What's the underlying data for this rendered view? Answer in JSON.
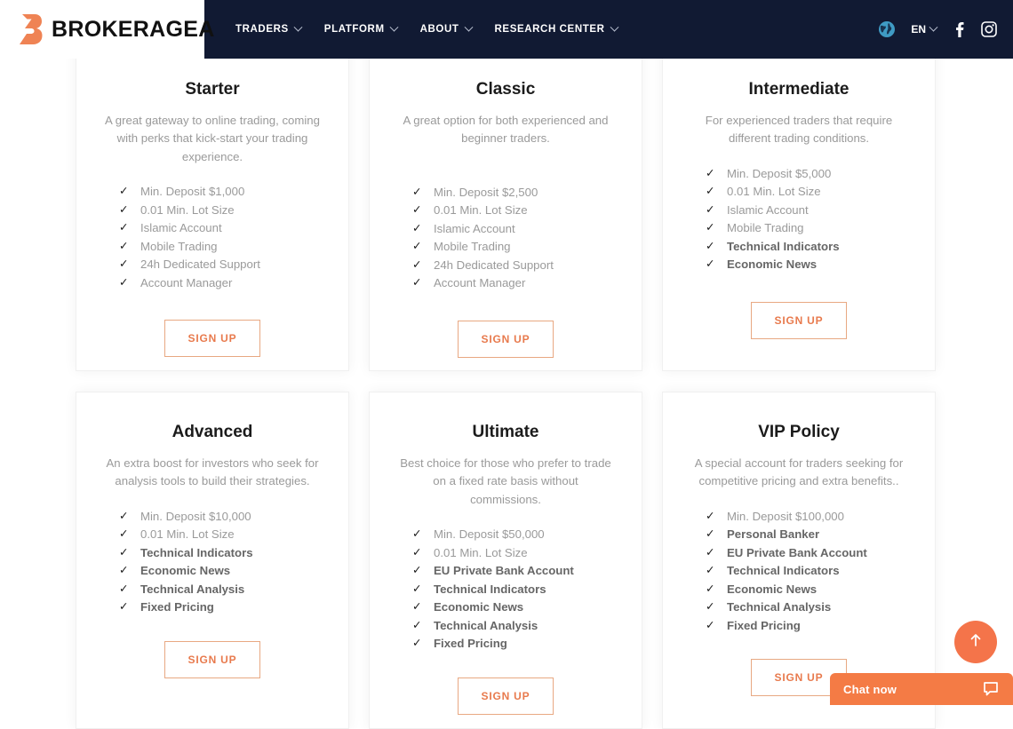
{
  "header": {
    "logo_text": "BROKERAGEA",
    "logo_icon": "brokeragea-b-logo",
    "nav": [
      {
        "label": "TRADERS"
      },
      {
        "label": "PLATFORM"
      },
      {
        "label": "ABOUT"
      },
      {
        "label": "RESEARCH CENTER"
      }
    ],
    "language": "EN",
    "icons": {
      "globe": "globe-icon",
      "facebook": "facebook-icon",
      "instagram": "instagram-icon"
    },
    "background_color": "#111a33"
  },
  "signup_label": "SIGN UP",
  "accent_color": "#f47b45",
  "button_border_color": "#e8a882",
  "button_text_color": "#e87a4d",
  "plans": [
    {
      "title": "Starter",
      "description": "A great gateway to online trading, coming with perks that kick-start your trading experience.",
      "features": [
        {
          "label": "Min. Deposit $1,000",
          "bold": false
        },
        {
          "label": "0.01 Min. Lot Size",
          "bold": false
        },
        {
          "label": "Islamic Account",
          "bold": false
        },
        {
          "label": "Mobile Trading",
          "bold": false
        },
        {
          "label": "24h Dedicated Support",
          "bold": false
        },
        {
          "label": "Account Manager",
          "bold": false
        }
      ]
    },
    {
      "title": "Classic",
      "description": "A great option for both experienced and beginner traders.",
      "features": [
        {
          "label": "Min. Deposit $2,500",
          "bold": false
        },
        {
          "label": "0.01 Min. Lot Size",
          "bold": false
        },
        {
          "label": "Islamic Account",
          "bold": false
        },
        {
          "label": "Mobile Trading",
          "bold": false
        },
        {
          "label": "24h Dedicated Support",
          "bold": false
        },
        {
          "label": "Account Manager",
          "bold": false
        }
      ]
    },
    {
      "title": "Intermediate",
      "description": "For experienced traders that require different trading conditions.",
      "features": [
        {
          "label": "Min. Deposit $5,000",
          "bold": false
        },
        {
          "label": "0.01 Min. Lot Size",
          "bold": false
        },
        {
          "label": "Islamic Account",
          "bold": false
        },
        {
          "label": "Mobile Trading",
          "bold": false
        },
        {
          "label": "Technical Indicators",
          "bold": true
        },
        {
          "label": "Economic News",
          "bold": true
        }
      ]
    },
    {
      "title": "Advanced",
      "description": "An extra boost for investors who seek for analysis tools to build their strategies.",
      "features": [
        {
          "label": "Min. Deposit $10,000",
          "bold": false
        },
        {
          "label": "0.01 Min. Lot Size",
          "bold": false
        },
        {
          "label": "Technical Indicators",
          "bold": true
        },
        {
          "label": "Economic News",
          "bold": true
        },
        {
          "label": "Technical Analysis",
          "bold": true
        },
        {
          "label": "Fixed Pricing",
          "bold": true
        }
      ]
    },
    {
      "title": "Ultimate",
      "description": "Best choice for those who prefer to trade on a fixed rate basis without commissions.",
      "features": [
        {
          "label": "Min. Deposit $50,000",
          "bold": false
        },
        {
          "label": "0.01 Min. Lot Size",
          "bold": false
        },
        {
          "label": "EU Private Bank Account",
          "bold": true
        },
        {
          "label": "Technical Indicators",
          "bold": true
        },
        {
          "label": "Economic News",
          "bold": true
        },
        {
          "label": "Technical Analysis",
          "bold": true
        },
        {
          "label": "Fixed Pricing",
          "bold": true
        }
      ]
    },
    {
      "title": "VIP Policy",
      "description": "A special account for traders seeking for competitive pricing and extra benefits..",
      "features": [
        {
          "label": "Min. Deposit $100,000",
          "bold": false
        },
        {
          "label": "Personal Banker",
          "bold": true
        },
        {
          "label": "EU Private Bank Account",
          "bold": true
        },
        {
          "label": "Technical Indicators",
          "bold": true
        },
        {
          "label": "Economic News",
          "bold": true
        },
        {
          "label": "Technical Analysis",
          "bold": true
        },
        {
          "label": "Fixed Pricing",
          "bold": true
        }
      ]
    }
  ],
  "floating": {
    "scroll_top_icon": "arrow-up-icon",
    "chat_label": "Chat now",
    "chat_icon": "chat-bubble-icon"
  }
}
